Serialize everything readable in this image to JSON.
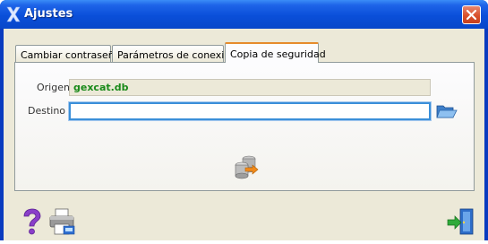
{
  "window": {
    "title": "Ajustes"
  },
  "tabs": [
    {
      "label": "Cambiar contraseña",
      "active": false
    },
    {
      "label": "Parámetros de conexión",
      "active": false
    },
    {
      "label": "Copia de seguridad",
      "active": true
    }
  ],
  "form": {
    "origen_label": "Origen",
    "origen_value": "gexcat.db",
    "destino_label": "Destino",
    "destino_value": ""
  },
  "icons": {
    "title": "app-x-icon",
    "close": "close-icon",
    "browse": "folder-open-icon",
    "backup": "database-backup-icon",
    "help": "help-question-icon",
    "print": "printer-icon",
    "exit": "exit-door-icon"
  },
  "colors": {
    "accent": "#e68b2c",
    "origen_text": "#1a8a1a",
    "focus_border": "#3b8fd9"
  }
}
